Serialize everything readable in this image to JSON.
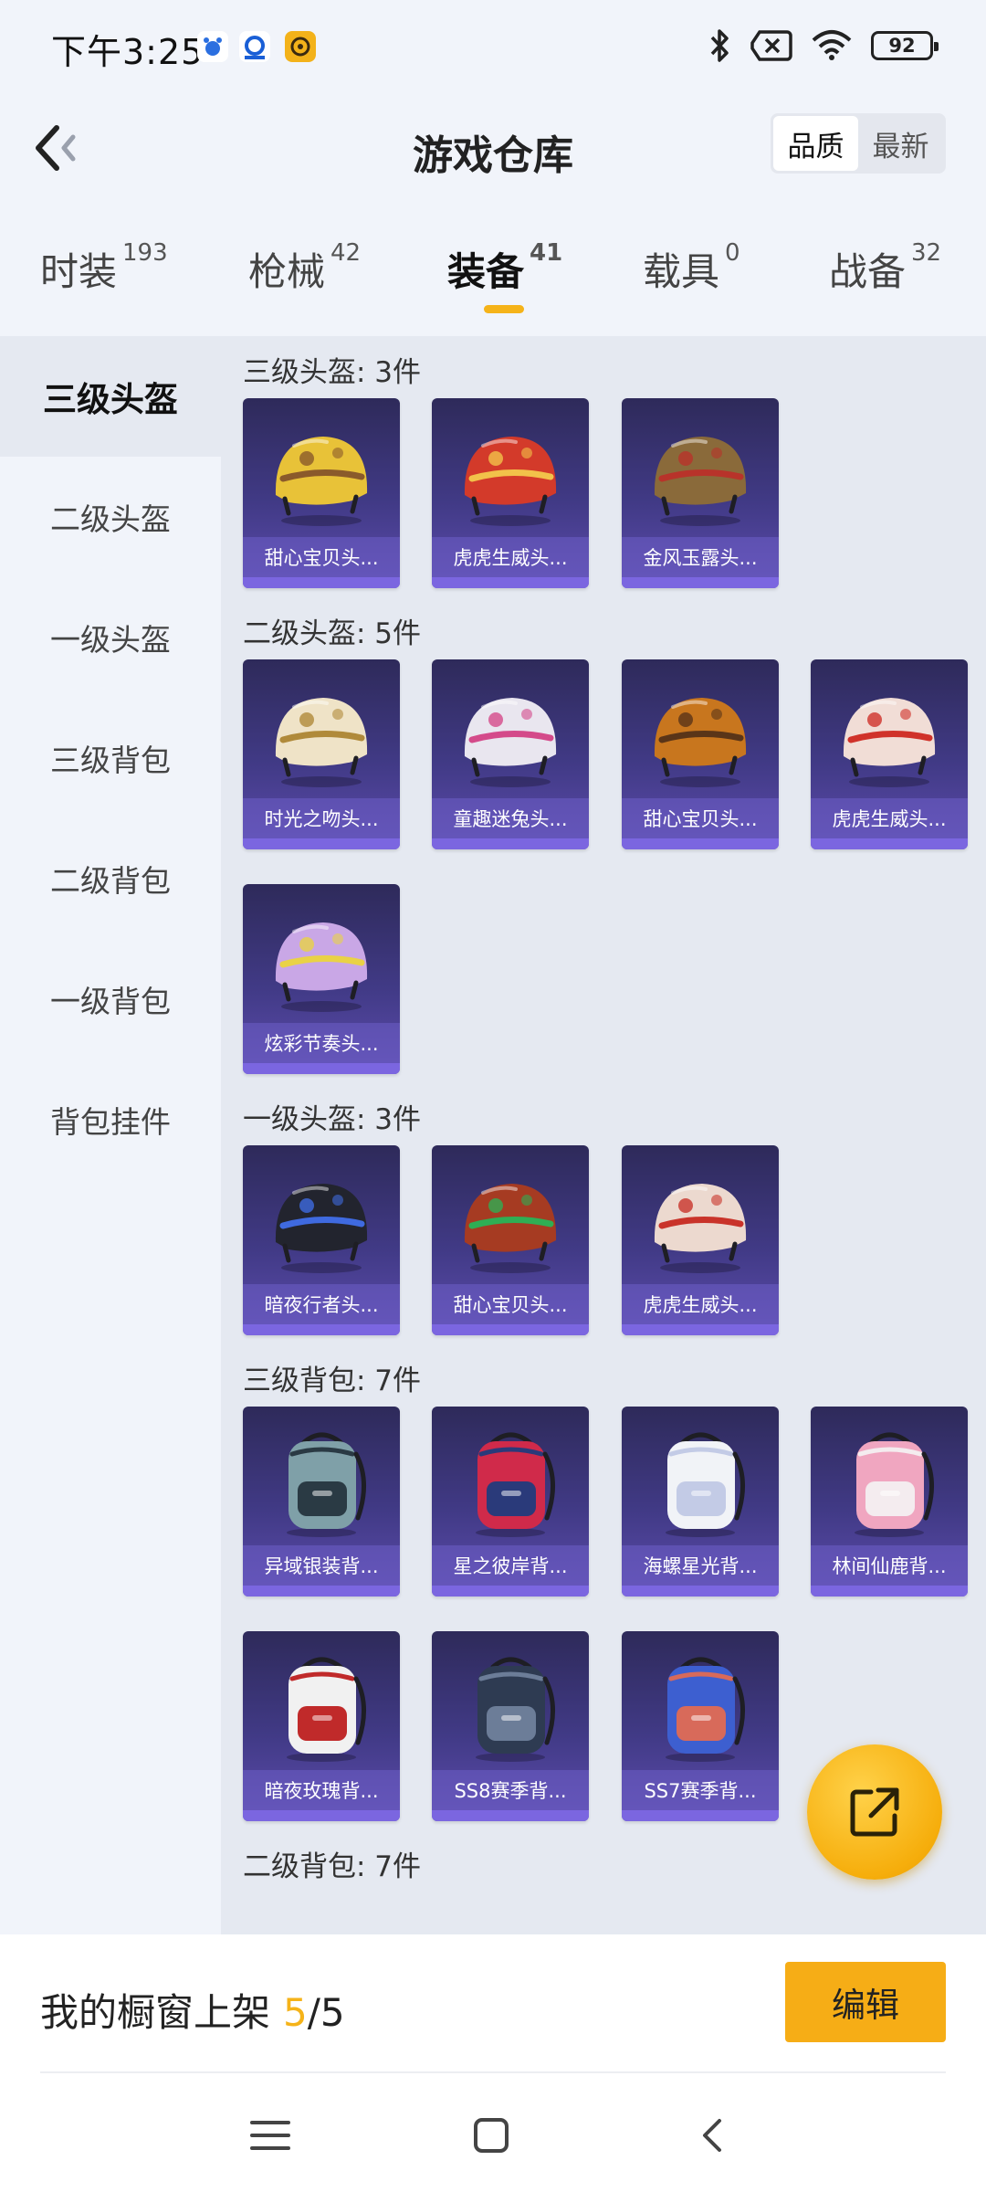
{
  "status_bar": {
    "time": "下午3:25",
    "battery": "92",
    "icons": [
      "baidu-app-icon",
      "app-icon",
      "app-icon",
      "bluetooth-icon",
      "sim-icon",
      "wifi-icon",
      "battery-icon"
    ]
  },
  "header": {
    "title": "游戏仓库",
    "sort_options": [
      "品质",
      "最新"
    ],
    "sort_active": "品质"
  },
  "tabs": [
    {
      "label": "时装",
      "count": "193"
    },
    {
      "label": "枪械",
      "count": "42"
    },
    {
      "label": "装备",
      "count": "41",
      "active": true
    },
    {
      "label": "载具",
      "count": "0"
    },
    {
      "label": "战备",
      "count": "32"
    }
  ],
  "sidebar": {
    "items": [
      "三级头盔",
      "二级头盔",
      "一级头盔",
      "三级背包",
      "二级背包",
      "一级背包",
      "背包挂件"
    ],
    "active": "三级头盔"
  },
  "sections": [
    {
      "title": "三级头盔: 3件",
      "items": [
        {
          "name": "甜心宝贝头...",
          "art": "helmet",
          "colors": [
            "#e8c238",
            "#8a5a2b"
          ]
        },
        {
          "name": "虎虎生威头...",
          "art": "helmet",
          "colors": [
            "#d33a2a",
            "#f2c24a"
          ]
        },
        {
          "name": "金风玉露头...",
          "art": "helmet",
          "colors": [
            "#8a6a3a",
            "#b8332a"
          ]
        }
      ]
    },
    {
      "title": "二级头盔: 5件",
      "items": [
        {
          "name": "时光之吻头...",
          "art": "helmet",
          "colors": [
            "#efe3c7",
            "#b08a3a"
          ]
        },
        {
          "name": "童趣迷兔头...",
          "art": "helmet",
          "colors": [
            "#e9e6ef",
            "#d44a8a"
          ]
        },
        {
          "name": "甜心宝贝头...",
          "art": "helmet",
          "colors": [
            "#c8761e",
            "#5a3518"
          ]
        },
        {
          "name": "虎虎生威头...",
          "art": "helmet",
          "colors": [
            "#f1ddd6",
            "#d0322a"
          ]
        },
        {
          "name": "炫彩节奏头...",
          "art": "helmet",
          "colors": [
            "#c9a7e6",
            "#e9d246"
          ]
        }
      ]
    },
    {
      "title": "一级头盔: 3件",
      "items": [
        {
          "name": "暗夜行者头...",
          "art": "helmet",
          "colors": [
            "#22242e",
            "#3f6ae0"
          ]
        },
        {
          "name": "甜心宝贝头...",
          "art": "helmet",
          "colors": [
            "#a63b22",
            "#2fae54"
          ]
        },
        {
          "name": "虎虎生威头...",
          "art": "helmet",
          "colors": [
            "#ecd9cf",
            "#c9332a"
          ]
        }
      ]
    },
    {
      "title": "三级背包: 7件",
      "items": [
        {
          "name": "异域银装背...",
          "art": "backpack",
          "colors": [
            "#7fa0a8",
            "#2a3a44"
          ]
        },
        {
          "name": "星之彼岸背...",
          "art": "backpack",
          "colors": [
            "#d02a4a",
            "#2a3a7a"
          ]
        },
        {
          "name": "海螺星光背...",
          "art": "backpack",
          "colors": [
            "#f1f3f7",
            "#c3cbe6"
          ]
        },
        {
          "name": "林间仙鹿背...",
          "art": "backpack",
          "colors": [
            "#f0a6c0",
            "#f4ecef"
          ]
        },
        {
          "name": "暗夜玫瑰背...",
          "art": "backpack",
          "colors": [
            "#f1f1f1",
            "#c02a2a"
          ]
        },
        {
          "name": "SS8赛季背...",
          "art": "backpack",
          "colors": [
            "#2e3b52",
            "#6c7d98"
          ]
        },
        {
          "name": "SS7赛季背...",
          "art": "backpack",
          "colors": [
            "#3d5fd0",
            "#d86a5a"
          ]
        }
      ]
    },
    {
      "title": "二级背包: 7件",
      "items": []
    }
  ],
  "footer": {
    "showcase_label": "我的橱窗上架",
    "showcase_count": "5",
    "showcase_total": "/5",
    "edit_label": "编辑"
  },
  "colors": {
    "accent": "#f5b319",
    "card_bg": "#3e3880",
    "page_bg": "#f1f4fa"
  }
}
